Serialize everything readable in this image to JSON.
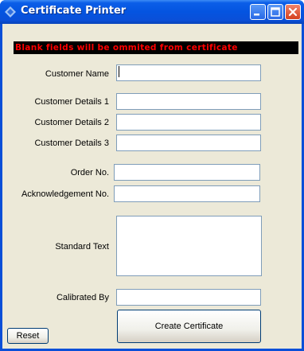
{
  "window": {
    "title": "Certificate Printer"
  },
  "banner": {
    "text": "Blank fields will be ommited from certificate"
  },
  "fields": {
    "customer_name": {
      "label": "Customer Name",
      "value": ""
    },
    "customer_details_1": {
      "label": "Customer Details 1",
      "value": ""
    },
    "customer_details_2": {
      "label": "Customer Details 2",
      "value": ""
    },
    "customer_details_3": {
      "label": "Customer Details 3",
      "value": ""
    },
    "order_no": {
      "label": "Order No.",
      "value": ""
    },
    "acknowledgement_no": {
      "label": "Acknowledgement No.",
      "value": ""
    },
    "standard_text": {
      "label": "Standard Text",
      "value": ""
    },
    "calibrated_by": {
      "label": "Calibrated By",
      "value": ""
    }
  },
  "buttons": {
    "reset": "Reset",
    "create": "Create Certificate"
  },
  "colors": {
    "titlebar": "#0a4fd8",
    "client_bg": "#ece9d8",
    "banner_bg": "#000000",
    "banner_text": "#ff0000",
    "close_button": "#d4401e"
  },
  "icons": {
    "app": "diamond-icon",
    "minimize": "minimize-icon",
    "maximize": "maximize-icon",
    "close": "close-icon"
  }
}
